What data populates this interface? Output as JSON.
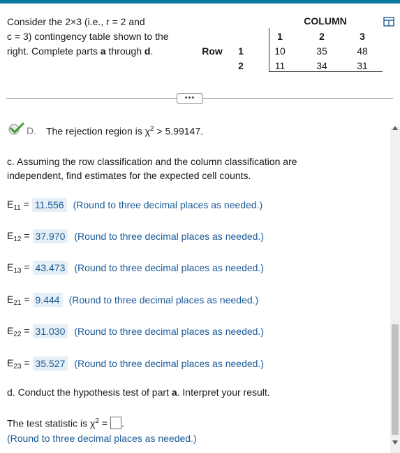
{
  "intro": {
    "line1": "Consider the 2×3 (i.e., r = 2 and",
    "line2": "c = 3) contingency table shown to the",
    "line3a": "right. Complete parts ",
    "part_a": "a",
    "line3b": " through ",
    "part_d": "d",
    "line3c": "."
  },
  "table": {
    "column_header": "COLUMN",
    "row_header": "Row",
    "columns": [
      "1",
      "2",
      "3"
    ],
    "rows": [
      {
        "label": "1",
        "values": [
          "10",
          "35",
          "48"
        ]
      },
      {
        "label": "2",
        "values": [
          "11",
          "34",
          "31"
        ]
      }
    ]
  },
  "ellipsis": "•••",
  "part_d_prev": {
    "letter": "D.",
    "text_prefix": "The rejection region is χ",
    "exponent": "2",
    "text_suffix": " > 5.99147."
  },
  "part_c": {
    "line1": "c. Assuming the row classification and the column classification are",
    "line2": "independent, find estimates for the expected cell counts.",
    "entries": [
      {
        "label": "E",
        "sub": "11",
        "value": "11.556",
        "note": "(Round to three decimal places as needed.)"
      },
      {
        "label": "E",
        "sub": "12",
        "value": "37.970",
        "note": "(Round to three decimal places as needed.)"
      },
      {
        "label": "E",
        "sub": "13",
        "value": "43.473",
        "note": "(Round to three decimal places as needed.)"
      },
      {
        "label": "E",
        "sub": "21",
        "value": "9.444",
        "note": "(Round to three decimal places as needed.)"
      },
      {
        "label": "E",
        "sub": "22",
        "value": "31.030",
        "note": "(Round to three decimal places as needed.)"
      },
      {
        "label": "E",
        "sub": "23",
        "value": "35.527",
        "note": "(Round to three decimal places as needed.)"
      }
    ]
  },
  "part_d": {
    "text_a": "d. Conduct the hypothesis test of part ",
    "part_ref": "a",
    "text_b": ". Interpret your result."
  },
  "test_stat": {
    "prefix": "The test statistic is χ",
    "exponent": "2",
    "equals": " =",
    "input_value": "",
    "period": ".",
    "note": "(Round to three decimal places as needed.)"
  }
}
